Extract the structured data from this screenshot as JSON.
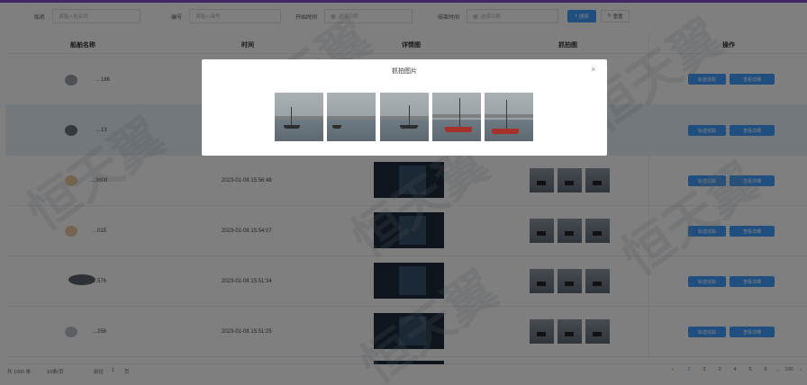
{
  "search": {
    "fields": [
      {
        "label": "船名",
        "placeholder": "请输入船名称"
      },
      {
        "label": "编号",
        "placeholder": "请输入编号"
      },
      {
        "label": "开始时间",
        "placeholder": "选择日期"
      },
      {
        "label": "结束时间",
        "placeholder": "选择日期"
      }
    ],
    "search_label": "搜索",
    "reset_label": "重置"
  },
  "table": {
    "headers": [
      "船舶名称",
      "时间",
      "详情图",
      "抓拍图",
      "操作"
    ],
    "rows": [
      {
        "name": "…186",
        "time": "",
        "highlight": false
      },
      {
        "name": "…13",
        "time": "",
        "highlight": true
      },
      {
        "name": "…3608",
        "time": "2023-01-08 15:56:48",
        "highlight": false
      },
      {
        "name": "…015",
        "time": "2023-01-08 15:54:07",
        "highlight": false
      },
      {
        "name": "…576",
        "time": "2023-01-08 15:51:34",
        "highlight": false
      },
      {
        "name": "…258",
        "time": "2023-01-08 15:51:25",
        "highlight": false
      }
    ],
    "actions": {
      "edit": "轨迹追踪",
      "detail": "查看详细"
    }
  },
  "footer": {
    "total": "共 1000 条",
    "page_size": "10条/页",
    "goto": "前往",
    "goto_page": "1",
    "goto_suffix": "页",
    "pages": [
      "‹",
      "1",
      "2",
      "3",
      "4",
      "5",
      "6",
      "…",
      "100",
      "›"
    ]
  },
  "watermark": "恒天翼",
  "dialog": {
    "title": "抓拍图片",
    "close": "×",
    "photos": [
      {
        "name": "photo-1",
        "boat": "dark"
      },
      {
        "name": "photo-2",
        "boat": "dark"
      },
      {
        "name": "photo-3",
        "boat": "dark"
      },
      {
        "name": "photo-4",
        "boat": "red"
      },
      {
        "name": "photo-5",
        "boat": "red"
      }
    ]
  },
  "colors": {
    "primary": "#409eff",
    "mask": "rgba(0,0,0,0.5)",
    "accent_line": "#7b4fc9"
  }
}
